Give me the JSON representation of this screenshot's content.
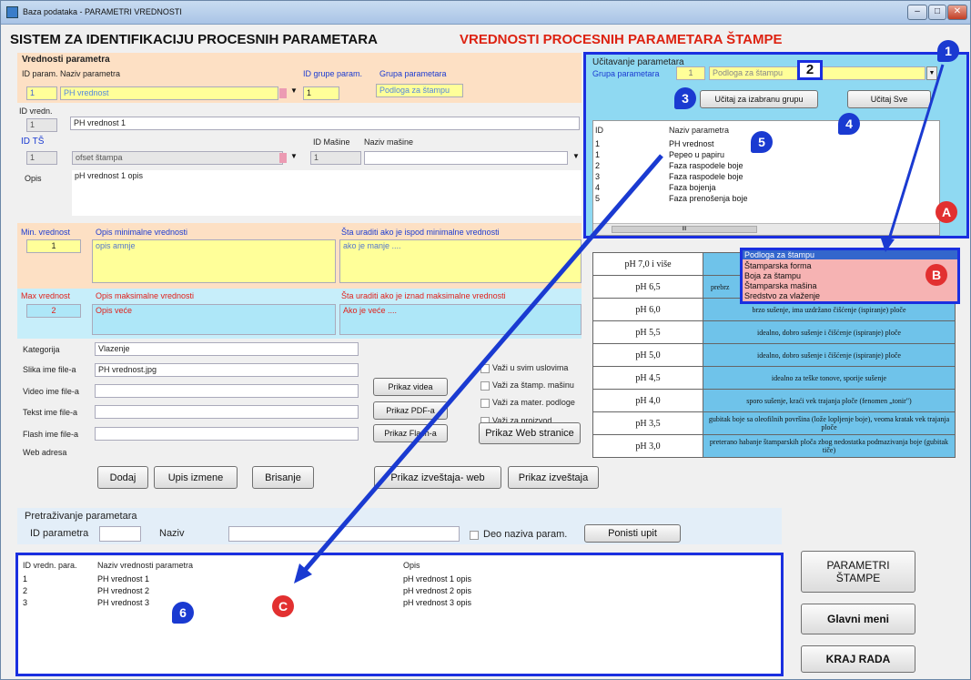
{
  "window": {
    "title": "Baza podataka - PARAMETRI VREDNOSTI"
  },
  "header": {
    "title": "SISTEM ZA IDENTIFIKACIJU PROCESNIH PARAMETARA",
    "subtitle": "VREDNOSTI PROCESNIH PARAMETARA ŠTAMPE"
  },
  "values_form": {
    "section_title": "Vrednosti parametra",
    "id_param_label": "ID param.",
    "naziv_label": "Naziv parametra",
    "id_param": "1",
    "naziv": "PH vrednost",
    "id_grupe_label": "ID grupe param.",
    "grupa_label": "Grupa parametara",
    "id_grupe": "1",
    "grupa": "Podloga za štampu",
    "id_vredn_label": "ID vredn.",
    "id_vredn": "1",
    "naziv_vredn": "PH vrednost 1",
    "id_ts_label": "ID TŠ",
    "id_ts": "1",
    "ts": "ofset štampa",
    "id_masine_label": "ID Mašine",
    "naziv_masine_label": "Naziv mašine",
    "id_masine": "1",
    "naziv_masine": "",
    "opis_label": "Opis",
    "opis": "pH vrednost 1 opis",
    "min_label": "Min. vrednost",
    "min_opis_label": "Opis minimalne vrednosti",
    "min_sta_label": "Šta uraditi ako je ispod minimalne vrednosti",
    "min": "1",
    "min_opis": "opis amnje",
    "min_sta": "ako je manje ....",
    "max_label": "Max vrednost",
    "max_opis_label": "Opis maksimalne vrednosti",
    "max_sta_label": "Šta uraditi ako je iznad maksimalne vrednosti",
    "max": "2",
    "max_opis": "Opis veće",
    "max_sta": "Ako je veće ....",
    "kategorija_label": "Kategorija",
    "kategorija": "Vlazenje",
    "slika_label": "Slika ime file-a",
    "slika": "PH vrednost.jpg",
    "video_label": "Video ime file-a",
    "tekst_label": "Tekst ime file-a",
    "flash_label": "Flash ime file-a",
    "web_label": "Web adresa",
    "chk1": "Važi u svim uslovima",
    "chk2": "Važi za štamp. mašinu",
    "chk3": "Važi za mater. podloge",
    "chk4": "Važi za proizvod",
    "btn_video": "Prikaz videa",
    "btn_pdf": "Prikaz PDF-a",
    "btn_flash": "Prikaz Flash-a",
    "btn_web": "Prikaz Web stranice",
    "btn_dodaj": "Dodaj",
    "btn_upis": "Upis izmene",
    "btn_brisanje": "Brisanje",
    "btn_izv_web": "Prikaz izveštaja- web",
    "btn_izv": "Prikaz izveštaja"
  },
  "loader": {
    "title": "Učitavanje parametara",
    "grupa_label": "Grupa parametara",
    "grupa_id": "1",
    "grupa": "Podloga za štampu",
    "btn_group": "Učitaj za izabranu grupu",
    "btn_all": "Učitaj Sve",
    "col_id": "ID",
    "col_naziv": "Naziv parametra",
    "rows": [
      {
        "id": "1",
        "naziv": "PH vrednost"
      },
      {
        "id": "1",
        "naziv": "Pepeo u papiru"
      },
      {
        "id": "2",
        "naziv": "Faza raspodele boje"
      },
      {
        "id": "3",
        "naziv": "Faza raspodele boje"
      },
      {
        "id": "4",
        "naziv": "Faza bojenja"
      },
      {
        "id": "5",
        "naziv": "Faza prenošenja boje"
      }
    ],
    "scroll_mark": "III"
  },
  "dropdown": {
    "items": [
      "Podloga za štampu",
      "Štamparska forma",
      "Boja za štampu",
      "Štamparska mašina",
      "Sredstvo za vlaženje"
    ]
  },
  "ph_table": [
    {
      "k": "pH 7,0 i više",
      "v": ""
    },
    {
      "k": "pH 6,5",
      "v": "prebrz"
    },
    {
      "k": "pH 6,0",
      "v": "brzo sušenje, ima uzdržano čišćenje (ispiranje) ploče"
    },
    {
      "k": "pH 5,5",
      "v": "idealno, dobro sušenje i čišćenje (ispiranje) ploče"
    },
    {
      "k": "pH 5,0",
      "v": "idealno, dobro sušenje i čišćenje (ispiranje) ploče"
    },
    {
      "k": "pH 4,5",
      "v": "idealno za teške tonove, sporije sušenje"
    },
    {
      "k": "pH 4,0",
      "v": "sporo sušenje, kraći vek trajanja ploče (fenomen „tonir\")"
    },
    {
      "k": "pH 3,5",
      "v": "gubitak boje sa oleofilnih površina (lože lopljenje boje), veoma kratak vek trajanja ploče"
    },
    {
      "k": "pH 3,0",
      "v": "preterano habanje štamparskih ploča zbog nedostatka podmazivanja boje (gubitak tiče)"
    }
  ],
  "search": {
    "title": "Pretraživanje parametara",
    "id_label": "ID parametra",
    "naziv_label": "Naziv",
    "deo_label": "Deo naziva param.",
    "btn": "Ponisti upit"
  },
  "results": {
    "col_id": "ID vredn. para.",
    "col_naziv": "Naziv vrednosti parametra",
    "col_opis": "Opis",
    "rows": [
      {
        "id": "1",
        "naziv": "PH vrednost 1",
        "opis": "pH vrednost 1 opis"
      },
      {
        "id": "2",
        "naziv": "PH vrednost 2",
        "opis": "pH vrednost 2 opis"
      },
      {
        "id": "3",
        "naziv": "PH vrednost 3",
        "opis": "pH vrednost 3 opis"
      }
    ]
  },
  "side": {
    "btn_parametri_1": "PARAMETRI",
    "btn_parametri_2": "ŠTAMPE",
    "btn_glavni": "Glavni meni",
    "btn_kraj": "KRAJ RADA"
  },
  "markers": {
    "m1": "1",
    "m2": "2",
    "m3": "3",
    "m4": "4",
    "m5": "5",
    "m6": "6",
    "A": "A",
    "B": "B",
    "C": "C"
  }
}
